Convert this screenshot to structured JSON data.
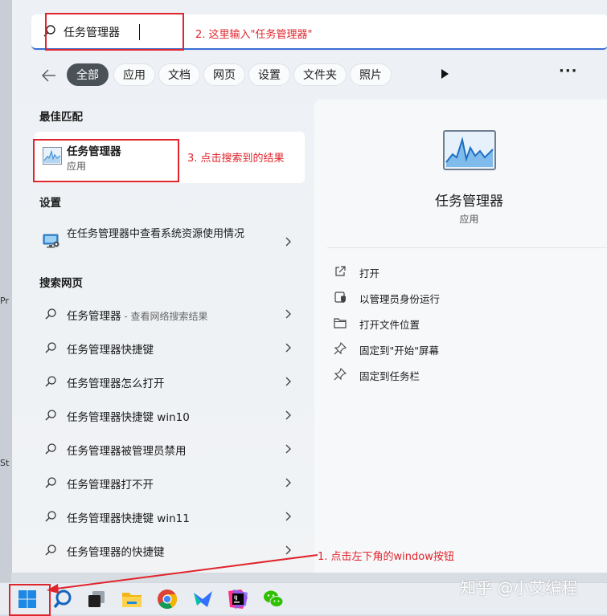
{
  "desktop": {
    "edge_labels": [
      "Pr",
      "St"
    ]
  },
  "search": {
    "value": "任务管理器",
    "placeholder": ""
  },
  "annotations": {
    "step1": "1. 点击左下角的window按钮",
    "step2": "2. 这里输入\"任务管理器\"",
    "step3": "3. 点击搜索到的结果",
    "color": "#e0242b"
  },
  "filters": {
    "tabs": [
      "全部",
      "应用",
      "文档",
      "网页",
      "设置",
      "文件夹",
      "照片"
    ],
    "active": "全部"
  },
  "sections": {
    "best_match": "最佳匹配",
    "settings": "设置",
    "web": "搜索网页"
  },
  "best_match": {
    "name": "任务管理器",
    "type": "应用",
    "icon": "task-manager-icon"
  },
  "settings_items": [
    {
      "label": "在任务管理器中查看系统资源使用情况",
      "icon": "monitor-settings-icon"
    }
  ],
  "web_results": [
    {
      "text": "任务管理器",
      "suffix": " - 查看网络搜索结果"
    },
    {
      "text": "任务管理器快捷键",
      "suffix": ""
    },
    {
      "text": "任务管理器怎么打开",
      "suffix": ""
    },
    {
      "text": "任务管理器快捷键 win10",
      "suffix": ""
    },
    {
      "text": "任务管理器被管理员禁用",
      "suffix": ""
    },
    {
      "text": "任务管理器打不开",
      "suffix": ""
    },
    {
      "text": "任务管理器快捷键 win11",
      "suffix": ""
    },
    {
      "text": "任务管理器的快捷键",
      "suffix": ""
    }
  ],
  "detail": {
    "name": "任务管理器",
    "type": "应用",
    "actions": [
      {
        "label": "打开",
        "icon": "open-external-icon"
      },
      {
        "label": "以管理员身份运行",
        "icon": "shield-admin-icon"
      },
      {
        "label": "打开文件位置",
        "icon": "folder-icon"
      },
      {
        "label": "固定到\"开始\"屏幕",
        "icon": "pin-icon"
      },
      {
        "label": "固定到任务栏",
        "icon": "pin-icon"
      }
    ]
  },
  "taskbar": {
    "items": [
      "windows-start-icon",
      "search-icon",
      "task-view-icon",
      "file-explorer-icon",
      "chrome-icon",
      "feishu-icon",
      "jetbrains-icon",
      "wechat-icon"
    ],
    "start_color": "#1e88e5"
  },
  "watermark": "知乎 @小艾编程"
}
